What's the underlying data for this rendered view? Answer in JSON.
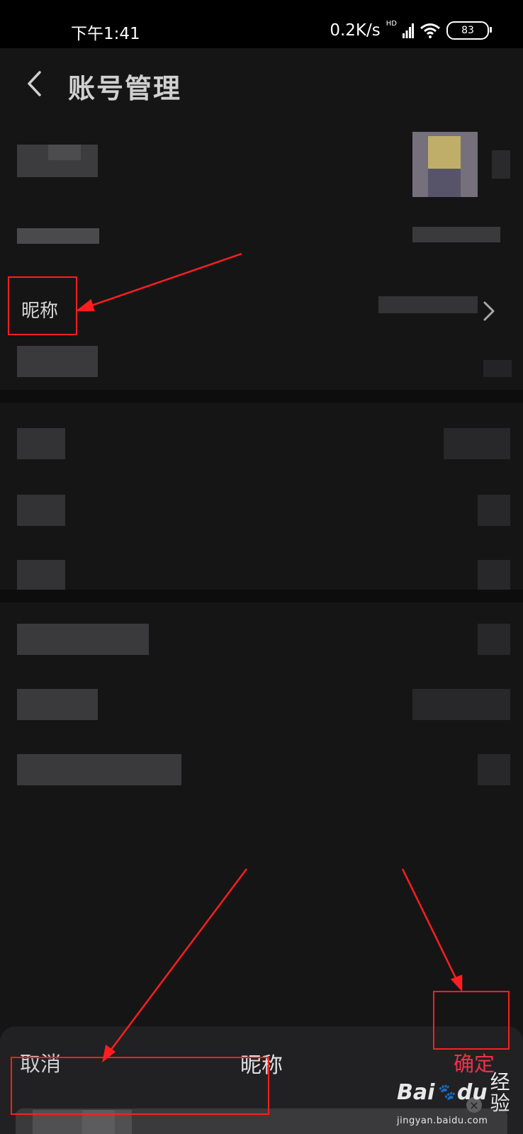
{
  "status_bar": {
    "time": "下午1:41",
    "speed": "0.2K/s",
    "hd_badge": "HD",
    "battery": "83"
  },
  "header": {
    "title": "账号管理",
    "back_icon": "back-chevron-icon"
  },
  "rows": {
    "nickname_label": "昵称",
    "chevron_icon": "chevron-right-icon"
  },
  "sheet": {
    "cancel": "取消",
    "title": "昵称",
    "confirm": "确定",
    "confirm_color": "#f0304c",
    "clear_icon": "clear-icon",
    "clear_glyph": "×"
  },
  "watermark": {
    "brand": "Bai",
    "paw": "🐾",
    "brand_suffix": "du",
    "service": "经验",
    "url": "jingyan.baidu.com"
  },
  "colors": {
    "page_bg": "#151516",
    "annotation_red": "#ff1e1e"
  }
}
